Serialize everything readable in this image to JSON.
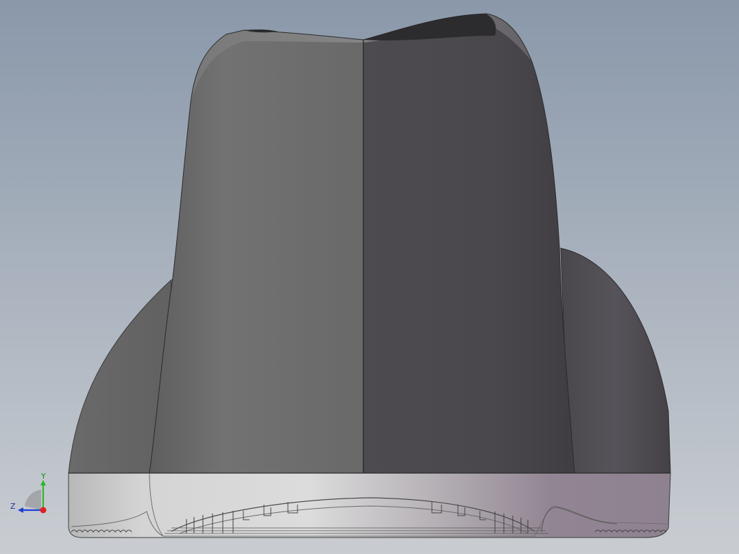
{
  "viewport": {
    "background_top": "#8a98aa",
    "background_bottom": "#c9cdd2"
  },
  "model": {
    "body_color_light": "#6e6e6e",
    "body_color_dark": "#4a474c",
    "base_color_light": "#d9d9d9",
    "base_color_tint": "#8e7f8c"
  },
  "triad": {
    "y_label": "Y",
    "z_label": "Z",
    "y_color": "#2fb52f",
    "z_color": "#1d3fd4",
    "x_color": "#e02020"
  }
}
